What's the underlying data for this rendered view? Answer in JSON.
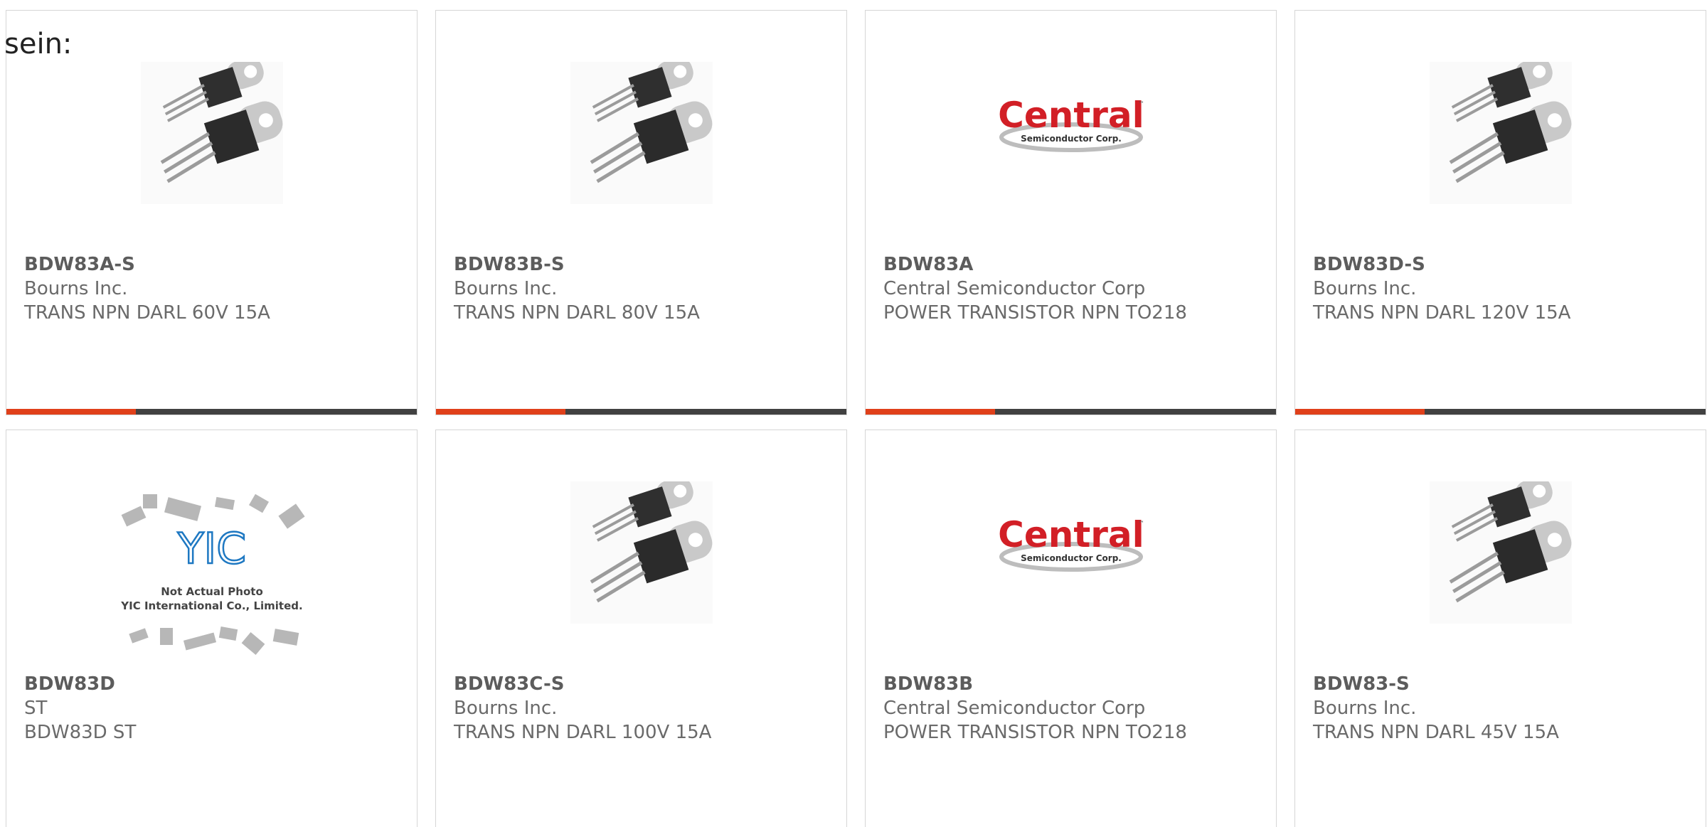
{
  "intro_text": "sein:",
  "colors": {
    "accent": "#e0401a",
    "bar": "#414141",
    "border": "#d6d6d6",
    "central_red": "#d21f26"
  },
  "products": [
    {
      "part": "BDW83A-S",
      "manufacturer": "Bourns Inc.",
      "description": "TRANS NPN DARL 60V 15A",
      "image": "to220-transistor-photo"
    },
    {
      "part": "BDW83B-S",
      "manufacturer": "Bourns Inc.",
      "description": "TRANS NPN DARL 80V 15A",
      "image": "to220-transistor-photo"
    },
    {
      "part": "BDW83A",
      "manufacturer": "Central Semiconductor Corp",
      "description": "POWER TRANSISTOR NPN TO218",
      "image": "central-logo"
    },
    {
      "part": "BDW83D-S",
      "manufacturer": "Bourns Inc.",
      "description": "TRANS NPN DARL 120V 15A",
      "image": "to220-transistor-photo"
    },
    {
      "part": "BDW83D",
      "manufacturer": "ST",
      "description": "BDW83D ST",
      "image": "yic-placeholder"
    },
    {
      "part": "BDW83C-S",
      "manufacturer": "Bourns Inc.",
      "description": "TRANS NPN DARL 100V 15A",
      "image": "to220-transistor-photo"
    },
    {
      "part": "BDW83B",
      "manufacturer": "Central Semiconductor Corp",
      "description": "POWER TRANSISTOR NPN TO218",
      "image": "central-logo"
    },
    {
      "part": "BDW83-S",
      "manufacturer": "Bourns Inc.",
      "description": "TRANS NPN DARL 45V 15A",
      "image": "to220-transistor-photo"
    }
  ],
  "central_logo": {
    "word": "Central",
    "sub": "Semiconductor Corp.",
    "tm": "™"
  },
  "yic_placeholder": {
    "mark": "YIC",
    "line1": "Not Actual Photo",
    "line2": "YIC International Co., Limited."
  }
}
